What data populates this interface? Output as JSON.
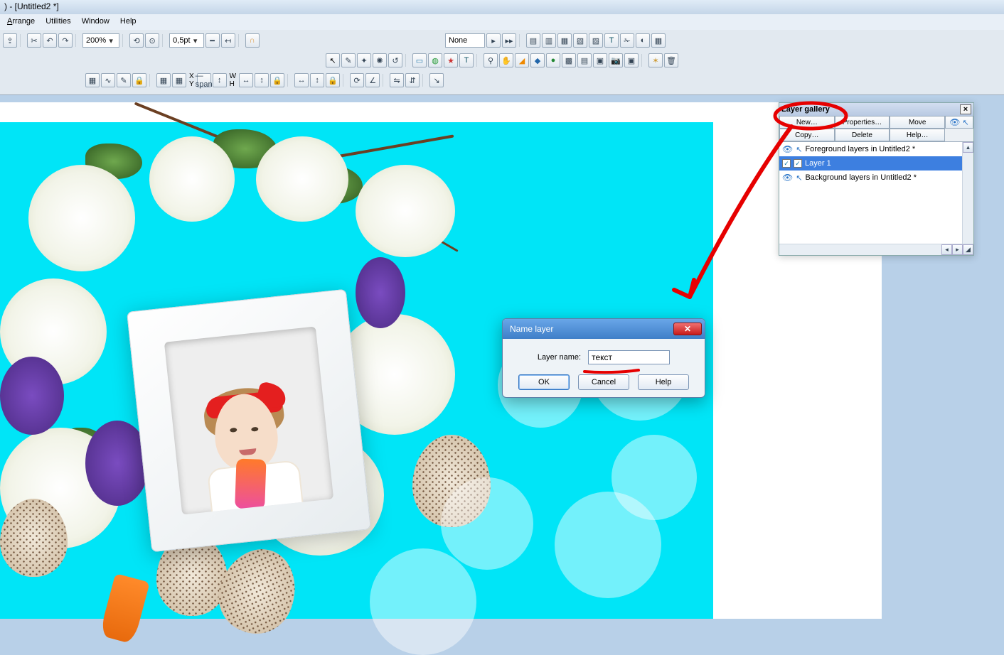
{
  "title": ") - [Untitled2 *]",
  "menu": {
    "arrange": "rrange",
    "utilities": "Utilities",
    "window": "Window",
    "help": "Help"
  },
  "toolbar": {
    "zoom": "200%",
    "stroke_pt": "0,5pt",
    "none_label": "None",
    "wh_w": "W",
    "wh_h": "H",
    "xy_x": "X",
    "xy_y": "Y"
  },
  "layer_gallery": {
    "title": "Layer gallery",
    "buttons": {
      "new": "New…",
      "properties": "Properties…",
      "move": "Move",
      "copy": "Copy…",
      "delete": "Delete",
      "help": "Help…"
    },
    "rows": {
      "fg": "Foreground layers in Untitled2 *",
      "layer1": "Layer 1",
      "bg": "Background layers in Untitled2 *"
    }
  },
  "name_dialog": {
    "title": "Name layer",
    "label": "Layer name:",
    "value": "текст",
    "ok": "OK",
    "cancel": "Cancel",
    "help": "Help"
  }
}
